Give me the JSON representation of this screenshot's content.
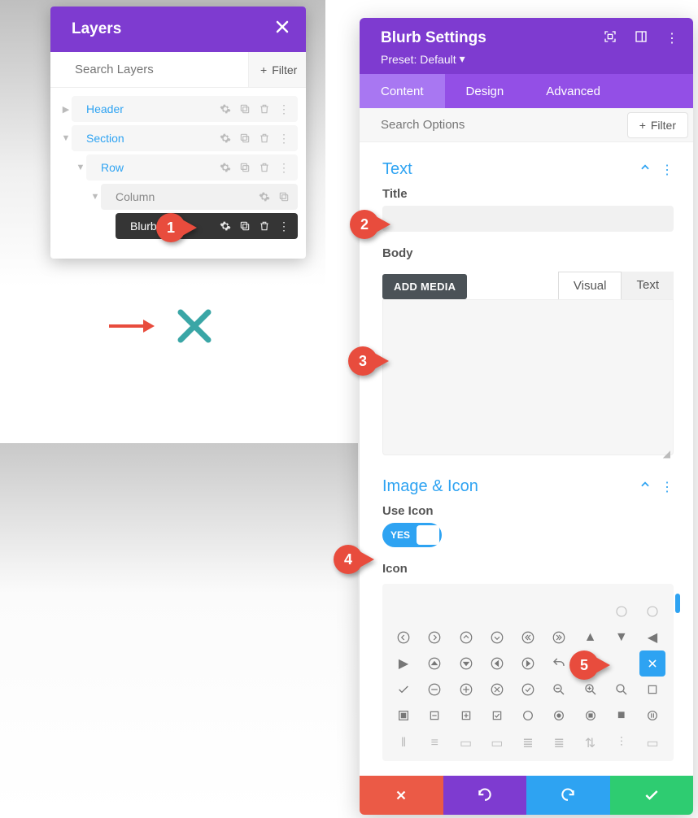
{
  "layers": {
    "title": "Layers",
    "search_placeholder": "Search Layers",
    "filter_label": "Filter",
    "items": {
      "header": "Header",
      "section": "Section",
      "row": "Row",
      "column": "Column",
      "blurb": "Blurb"
    }
  },
  "settings": {
    "title": "Blurb Settings",
    "preset": "Preset: Default",
    "tabs": {
      "content": "Content",
      "design": "Design",
      "advanced": "Advanced"
    },
    "search_placeholder": "Search Options",
    "filter_label": "Filter",
    "text_section": "Text",
    "title_label": "Title",
    "body_label": "Body",
    "add_media": "ADD MEDIA",
    "visual": "Visual",
    "text_tab": "Text",
    "image_section": "Image & Icon",
    "use_icon_label": "Use Icon",
    "toggle_yes": "YES",
    "icon_label": "Icon"
  },
  "callouts": {
    "c1": "1",
    "c2": "2",
    "c3": "3",
    "c4": "4",
    "c5": "5"
  }
}
